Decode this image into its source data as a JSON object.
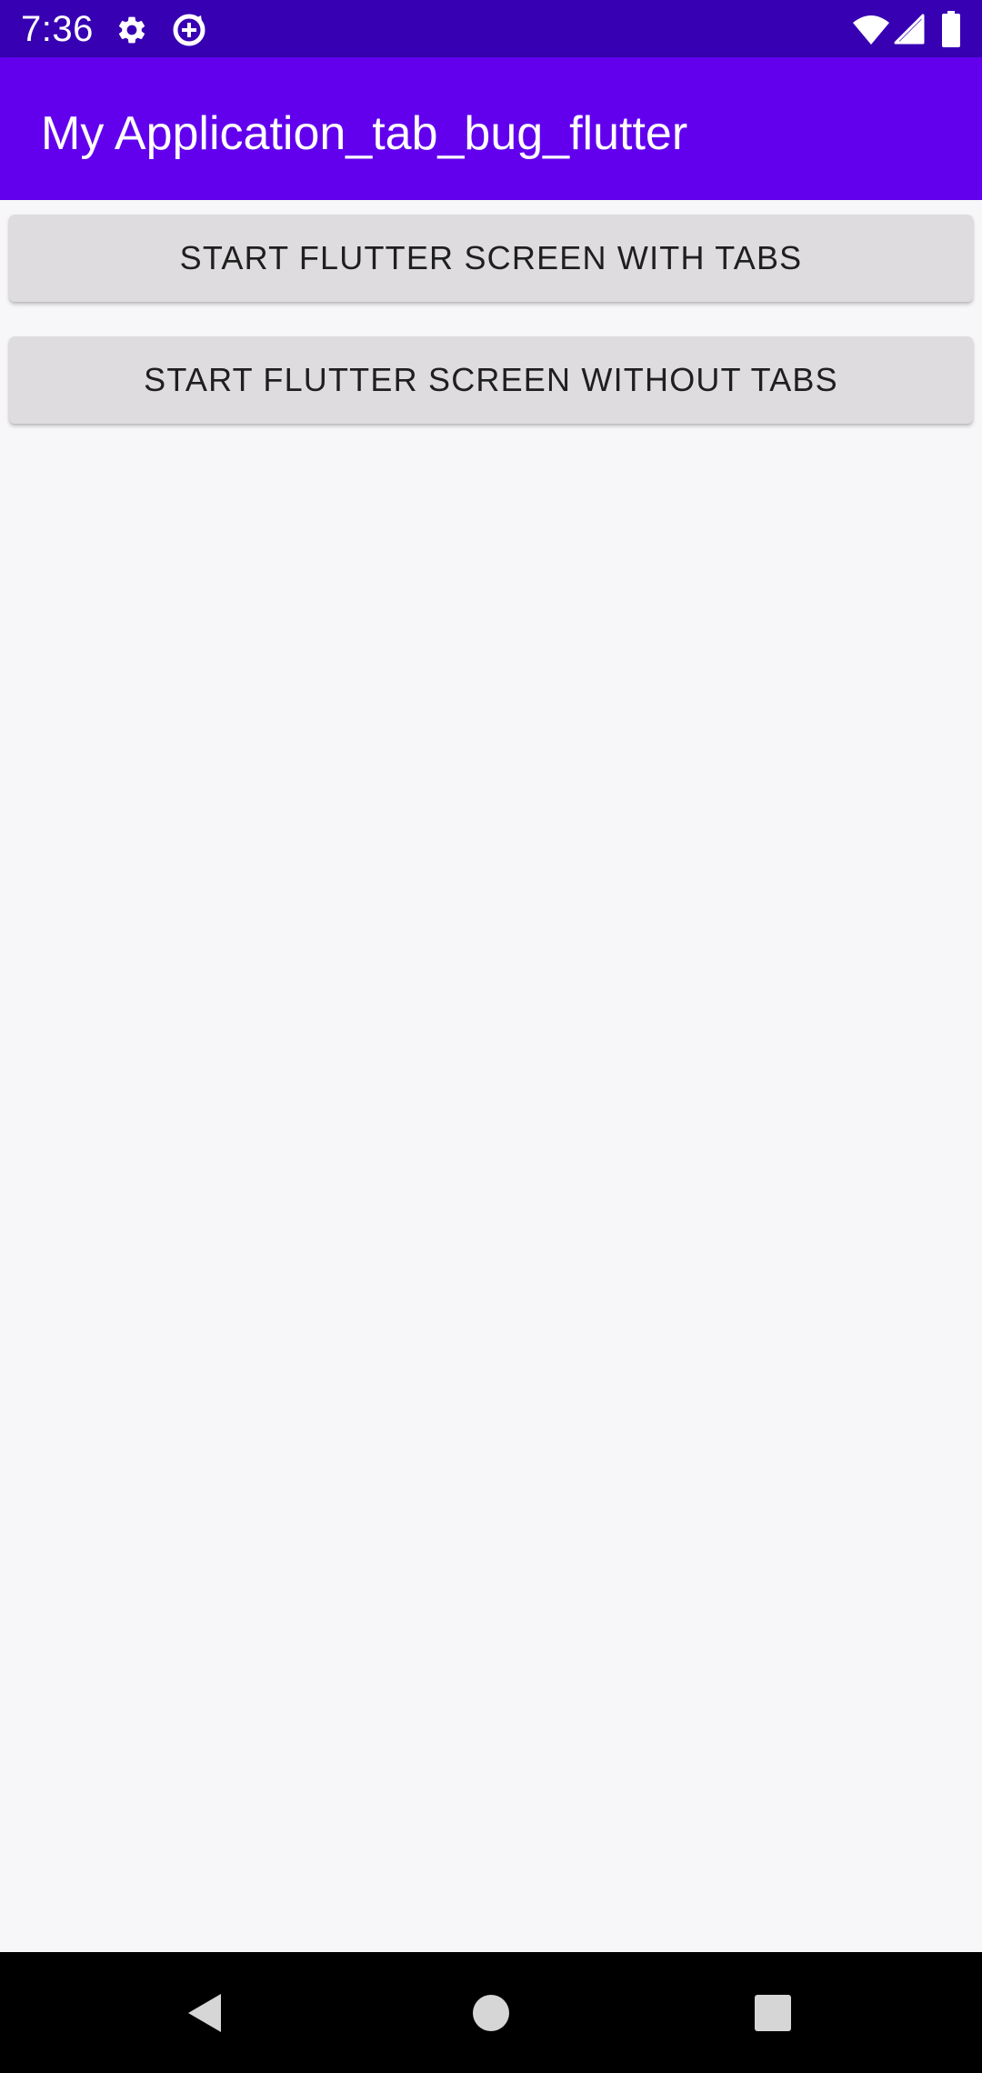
{
  "status_bar": {
    "time": "7:36",
    "icons": [
      "gear-icon",
      "data-saver-icon",
      "wifi-icon",
      "cell-signal-icon",
      "battery-icon"
    ],
    "background": "#3700b3"
  },
  "app_bar": {
    "title": "My Application_tab_bug_flutter",
    "background": "#6200ee"
  },
  "main": {
    "buttons": [
      {
        "label": "START FLUTTER SCREEN WITH TABS"
      },
      {
        "label": "START FLUTTER SCREEN WITHOUT TABS"
      }
    ]
  },
  "nav_bar": {
    "items": [
      "back-icon",
      "home-icon",
      "recents-icon"
    ],
    "background": "#000000"
  }
}
